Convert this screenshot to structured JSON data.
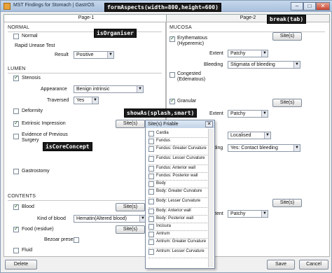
{
  "window": {
    "title": "MST Findings for Stomach | GastrOS",
    "min": "–",
    "max": "□",
    "close": "✕"
  },
  "tabs": [
    {
      "label": "Page-1"
    },
    {
      "label": "Page-2"
    }
  ],
  "annotations": {
    "form": "formAspects(width=800,height=600)",
    "organiser": "isOrganiser",
    "break": "break(tab)",
    "show": "showAs(splash,smart)",
    "core": "isCoreConcept"
  },
  "left": {
    "normal": {
      "heading": "NORMAL",
      "normal": "Normal",
      "rut": "Rapid Urease Test",
      "result_label": "Result",
      "result_value": "Positive"
    },
    "lumen": {
      "heading": "LUMEN",
      "stenosis": "Stenosis",
      "appearance_label": "Appearance",
      "appearance_value": "Benign intrinsic",
      "traversed_label": "Traversed",
      "traversed_value": "Yes",
      "deformity": "Deformity",
      "extrinsic": "Extrinsic Impression",
      "previous": "Evidence of Previous Surgery",
      "gastrostomy": "Gastrostomy"
    },
    "contents": {
      "heading": "CONTENTS",
      "blood": "Blood",
      "kind_label": "Kind of blood",
      "kind_value": "Hematin(Altered blood)",
      "food": "Food (residue)",
      "bezoar": "Bezoar present",
      "fluid": "Fluid"
    }
  },
  "right": {
    "heading": "MUCOSA",
    "erythematous": "Erythematous (Hyperemic)",
    "extent_label": "Extent",
    "extent_value": "Patchy",
    "bleeding_label": "Bleeding",
    "bleeding_value": "Stigmata of bleeding",
    "congested": "Congested (Edematous)",
    "granular": "Granular",
    "extent2_value": "Patchy",
    "localised_value": "Localised",
    "bleeding2_value": "Yes: Contact bleeding",
    "extent3_value": "Patchy"
  },
  "sites_label": "Site(s)",
  "popup": {
    "title": "Site(s)  Friable",
    "close": "✕",
    "items": [
      "Cardia",
      "Fundus",
      "Fundus: Greater Curvature",
      "Fundus: Lesser Curvature",
      "Fundus: Anterior wall",
      "Fundus: Posterior wall",
      "Body",
      "Body: Greater Curvature",
      "Body: Lesser Curvature",
      "Body: Anterior wall",
      "Body: Posterior wall",
      "Incisura",
      "Antrum",
      "Antrum: Greater Curvature",
      "Antrum: Lesser Curvature"
    ]
  },
  "footer": {
    "delete": "Delete",
    "save": "Save",
    "cancel": "Cancel"
  }
}
